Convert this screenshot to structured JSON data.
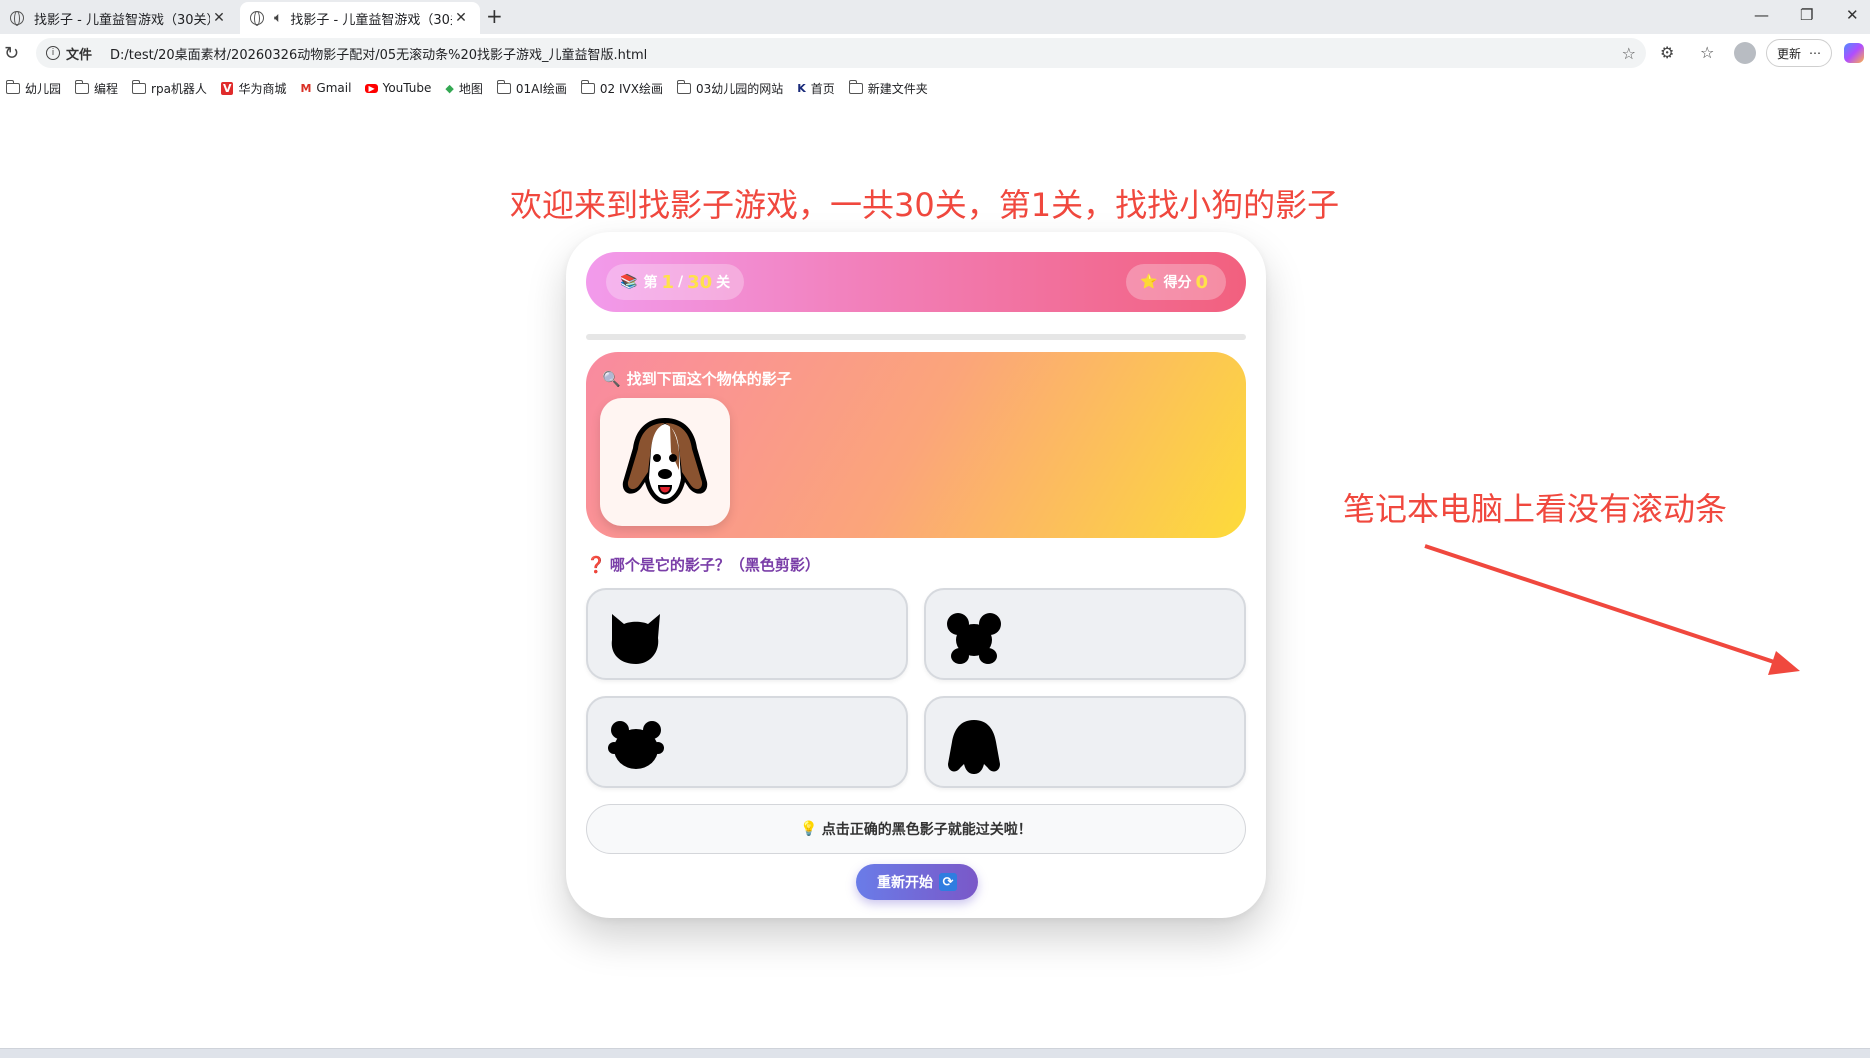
{
  "browser": {
    "tabs": [
      {
        "title": "找影子 - 儿童益智游戏（30关）",
        "active": false
      },
      {
        "title": "找影子 - 儿童益智游戏（30关）",
        "active": true
      }
    ],
    "address": {
      "protocol_label": "文件",
      "url": "D:/test/20桌面素材/20260326动物影子配对/05无滚动条%20找影子游戏_儿童益智版.html"
    },
    "update_label": "更新",
    "bookmarks": [
      {
        "label": "幼儿园",
        "icon": "folder-icon"
      },
      {
        "label": "编程",
        "icon": "folder-icon"
      },
      {
        "label": "rpa机器人",
        "icon": "folder-icon"
      },
      {
        "label": "华为商城",
        "icon": "huawei-icon"
      },
      {
        "label": "Gmail",
        "icon": "gmail-icon"
      },
      {
        "label": "YouTube",
        "icon": "youtube-icon"
      },
      {
        "label": "地图",
        "icon": "maps-icon"
      },
      {
        "label": "01AI绘画",
        "icon": "folder-icon"
      },
      {
        "label": "02 IVX绘画",
        "icon": "folder-icon"
      },
      {
        "label": "03幼儿园的网站",
        "icon": "folder-icon"
      },
      {
        "label": "首页",
        "icon": "k-icon"
      },
      {
        "label": "新建文件夹",
        "icon": "folder-icon"
      }
    ]
  },
  "annotations": {
    "top": "欢迎来到找影子游戏，一共30关，第1关，找找小狗的影子",
    "right": "笔记本电脑上看没有滚动条",
    "color": "#f0483e"
  },
  "game": {
    "level": {
      "prefix": "第",
      "current": "1",
      "separator": "/",
      "total": "30",
      "suffix": "关",
      "progress_fraction": 0.0
    },
    "score": {
      "label": "得分",
      "value": "0"
    },
    "target": {
      "prompt": "找到下面这个物体的影子",
      "animal": "dog",
      "icon": "dog-face-icon"
    },
    "question": "哪个是它的影子？（黑色剪影）",
    "choices": [
      {
        "shape": "cat-silhouette-icon"
      },
      {
        "shape": "mouse-silhouette-icon"
      },
      {
        "shape": "bear-silhouette-icon"
      },
      {
        "shape": "dog-silhouette-icon"
      }
    ],
    "hint": "点击正确的黑色影子就能过关啦！",
    "restart_label": "重新开始"
  },
  "colors": {
    "header_gradient": [
      "#f29bec",
      "#f2607e"
    ],
    "target_gradient": [
      "#f98aa0",
      "#fddb3a"
    ],
    "button_gradient": [
      "#6a7ce8",
      "#7a58c8"
    ],
    "highlight_number": "#ffe14a"
  }
}
